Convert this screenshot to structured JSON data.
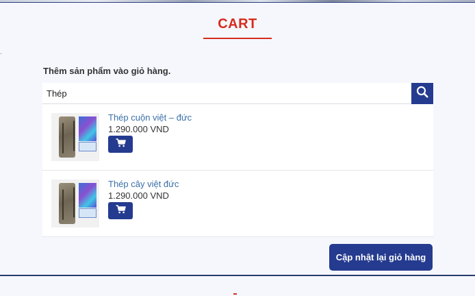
{
  "page": {
    "title": "CART",
    "add_label": "Thêm sản phẩm vào giỏ hàng."
  },
  "search": {
    "value": "Thép",
    "placeholder": ""
  },
  "results": [
    {
      "name": "Thép cuộn việt – đức",
      "price": "1.290.000 VND"
    },
    {
      "name": "Thép cây việt đức",
      "price": "1.290.000 VND"
    }
  ],
  "actions": {
    "update_label": "Cập nhật lại giỏ hàng"
  },
  "icons": {
    "search": "search-icon",
    "cart": "cart-icon"
  },
  "colors": {
    "accent": "#253b8f",
    "title_red": "#d62b1f",
    "link": "#3a6fa8"
  }
}
